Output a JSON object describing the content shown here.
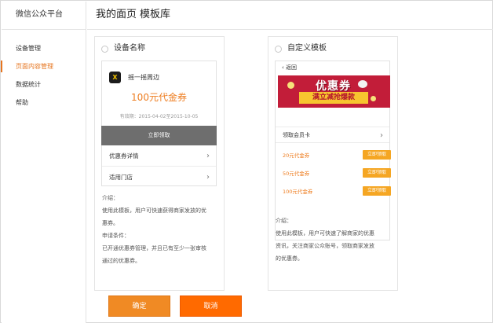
{
  "app": {
    "title": "微信公众平台"
  },
  "sidebar": {
    "items": [
      {
        "label": "设备管理",
        "active": false
      },
      {
        "label": "页面内容管理",
        "active": true
      },
      {
        "label": "数据统计",
        "active": false
      },
      {
        "label": "帮助",
        "active": false
      }
    ]
  },
  "page": {
    "title": "我的面页",
    "subtitle": "模板库"
  },
  "templates": {
    "left": {
      "header": "设备名称",
      "mock": {
        "logo_text": "X",
        "shop_name": "摇一摇周边",
        "coupon_value": "100元代金券",
        "valid_period": "有效期：2015-04-02至2015-10-05",
        "claim_button": "立即领取",
        "rows": [
          "优惠券详情",
          "适用门店"
        ]
      },
      "description": [
        "介绍：",
        "使用此模板，用户可快速获得商家发放的优",
        "惠券。",
        "申请条件：",
        "已开通优惠券管理，并且已有至少一张审核",
        "通过的优惠券。"
      ]
    },
    "right": {
      "header": "自定义模板",
      "mock": {
        "back_label": "返回",
        "banner_title": "优惠券",
        "banner_subtitle": "满立减抢爆款",
        "member_card": "领取会员卡",
        "coupons": [
          {
            "label": "20元代金券",
            "button": "立即领取"
          },
          {
            "label": "50元代金券",
            "button": "立即领取"
          },
          {
            "label": "100元代金券",
            "button": "立即领取"
          }
        ]
      },
      "description": [
        "介绍：",
        "使用此模板，用户可快速了解商家的优惠",
        "资讯，关注商家公众账号，领取商家发放",
        "的优惠券。"
      ]
    }
  },
  "footer": {
    "confirm": "确定",
    "cancel": "取消"
  },
  "colors": {
    "accent": "#e6751f",
    "confirm_button": "#f08a24",
    "cancel_button": "#ff6a00",
    "banner": "#c21d39"
  }
}
